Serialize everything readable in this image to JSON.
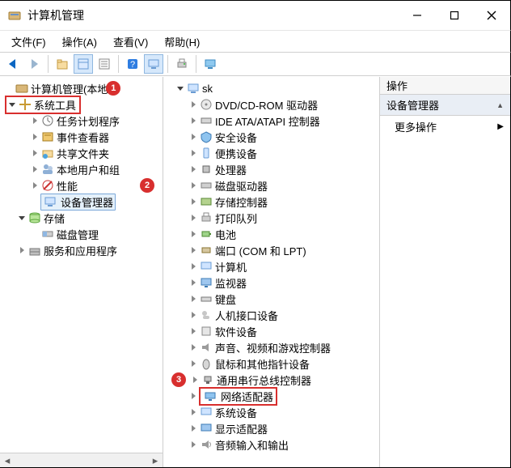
{
  "window": {
    "title": "计算机管理"
  },
  "menu": {
    "file": "文件(F)",
    "action": "操作(A)",
    "view": "查看(V)",
    "help": "帮助(H)"
  },
  "tree_left": {
    "root": "计算机管理(本地",
    "system_tools": "系统工具",
    "task_scheduler": "任务计划程序",
    "event_viewer": "事件查看器",
    "shared_folders": "共享文件夹",
    "local_users": "本地用户和组",
    "performance": "性能",
    "device_manager": "设备管理器",
    "storage": "存储",
    "disk_management": "磁盘管理",
    "services": "服务和应用程序"
  },
  "tree_center": {
    "root": "sk",
    "dvd": "DVD/CD-ROM 驱动器",
    "ide": "IDE ATA/ATAPI 控制器",
    "security": "安全设备",
    "portable": "便携设备",
    "cpu": "处理器",
    "disk_drive": "磁盘驱动器",
    "storage_ctrl": "存储控制器",
    "print_queue": "打印队列",
    "battery": "电池",
    "ports": "端口 (COM 和 LPT)",
    "computer": "计算机",
    "monitor": "监视器",
    "keyboard": "键盘",
    "hid": "人机接口设备",
    "software_dev": "软件设备",
    "sound": "声音、视频和游戏控制器",
    "mouse": "鼠标和其他指针设备",
    "usb": "通用串行总线控制器",
    "network": "网络适配器",
    "system_dev": "系统设备",
    "display": "显示适配器",
    "audio_io": "音频输入和输出"
  },
  "actions": {
    "header": "操作",
    "section": "设备管理器",
    "more": "更多操作"
  },
  "annotations": {
    "badge1": "1",
    "badge2": "2",
    "badge3": "3"
  }
}
